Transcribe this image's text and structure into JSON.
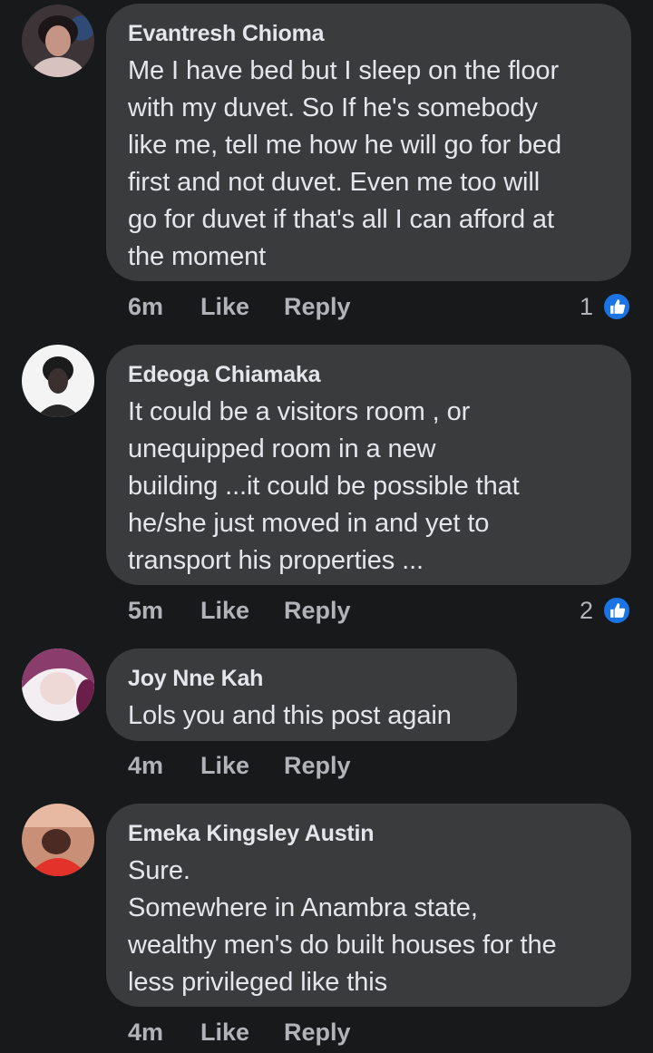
{
  "comments": [
    {
      "author": "Evantresh Chioma",
      "text": "Me I have bed but I sleep on the floor\nwith my duvet. So If he's somebody\nlike me, tell me how he will go for bed\nfirst and not duvet. Even me too will\ngo for duvet if that's all I can afford at\nthe moment",
      "time": "6m",
      "like_label": "Like",
      "reply_label": "Reply",
      "reaction_count": "1",
      "avatar_colors": [
        "#c9a79a",
        "#2c2530"
      ]
    },
    {
      "author": "Edeoga Chiamaka",
      "text": "It could be a visitors room , or\nunequipped room in a new\nbuilding ...it could be possible that\nhe/she just moved in and yet to\ntransport his properties ...",
      "time": "5m",
      "like_label": "Like",
      "reply_label": "Reply",
      "reaction_count": "2",
      "avatar_colors": [
        "#f2f2f2",
        "#1e1e1e"
      ]
    },
    {
      "author": "Joy Nne Kah",
      "text": "Lols you and this post again",
      "time": "4m",
      "like_label": "Like",
      "reply_label": "Reply",
      "avatar_colors": [
        "#e7d2e0",
        "#b04a8a"
      ]
    },
    {
      "author": "Emeka Kingsley Austin",
      "text": "Sure.\nSomewhere in Anambra state,\nwealthy men's do built houses for the\nless privileged like this",
      "time": "4m",
      "like_label": "Like",
      "reply_label": "Reply",
      "avatar_colors": [
        "#d9a08a",
        "#e53a2c"
      ]
    }
  ],
  "colors": {
    "background": "#18191a",
    "bubble": "#3a3b3c",
    "text": "#e4e6eb",
    "secondary_text": "#b0b3b8",
    "like_blue": "#1b74e4"
  },
  "icons": {
    "like": "thumbs-up-icon"
  }
}
